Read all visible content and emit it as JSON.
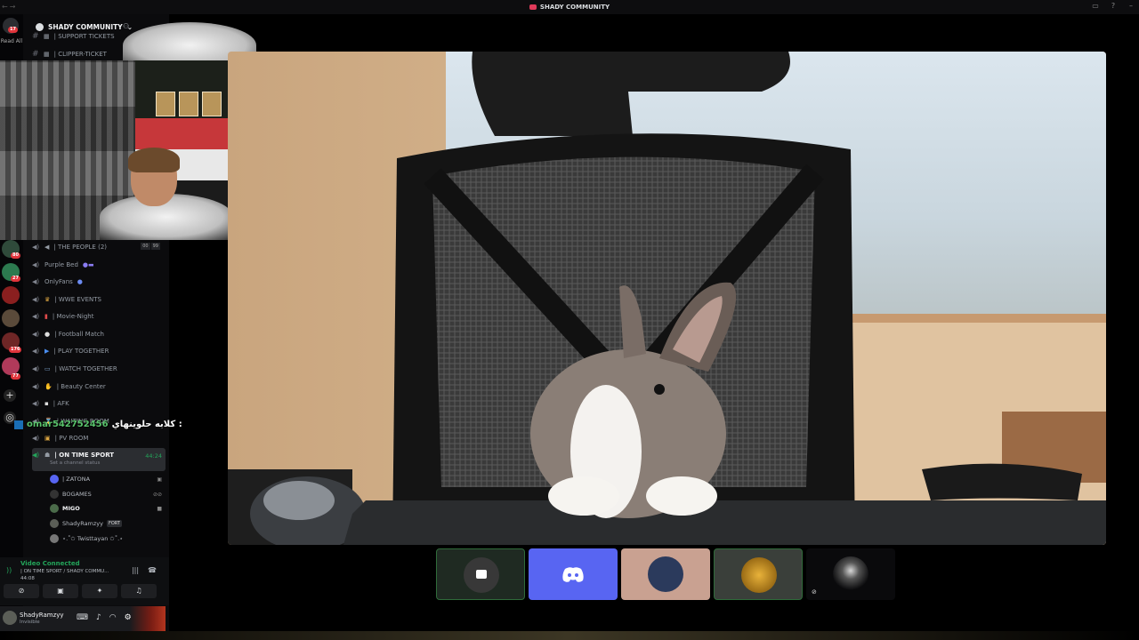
{
  "window": {
    "title": "SHADY COMMUNITY"
  },
  "rail": {
    "read_all": "Read All",
    "badges": [
      "17",
      "80",
      "27",
      "176",
      "77"
    ]
  },
  "server": {
    "name": "SHADY COMMUNITY",
    "top_channels": [
      {
        "icon": "ticket-icon",
        "label": "| SUPPORT TICKETS"
      },
      {
        "icon": "ticket-icon",
        "label": "| CLIPPER-TICKET"
      }
    ],
    "voice_channels": [
      {
        "icon": "speaker-icon",
        "label": "| THE PEOPLE (2)",
        "limit_a": "00",
        "limit_b": "99"
      },
      {
        "icon": "bed-icon",
        "label": "Purple Bed"
      },
      {
        "icon": "globe-icon",
        "label": "OnlyFans"
      },
      {
        "icon": "wrestler-icon",
        "label": "| WWE EVENTS"
      },
      {
        "icon": "popcorn-icon",
        "label": "| Movie-Night"
      },
      {
        "icon": "soccer-icon",
        "label": "| Football Match"
      },
      {
        "icon": "play-icon",
        "label": "| PLAY TOGETHER"
      },
      {
        "icon": "tv-icon",
        "label": "| WATCH TOGETHER"
      },
      {
        "icon": "nail-icon",
        "label": "| Beauty Center"
      },
      {
        "icon": "chat-icon",
        "label": "| AFK"
      },
      {
        "icon": "hourglass-icon",
        "label": "| WAITING ROOM"
      },
      {
        "icon": "lock-icon",
        "label": "| PV ROOM"
      }
    ],
    "active_channel": {
      "label": "| ON TIME SPORT",
      "timer": "44:24",
      "status": "Set a channel status"
    },
    "voice_users": [
      {
        "name": "| ZATONA",
        "color": "#5865f2"
      },
      {
        "name": "BOGAMES",
        "color": "#333333"
      },
      {
        "name": "MIGO",
        "color": "#4b6b4a"
      },
      {
        "name": "ShadyRamzyy",
        "tag": "FORT",
        "color": "#5b5e57"
      },
      {
        "name": "⋆.˚✩ Twisttayan ✩˚.⋆",
        "color": "#777777"
      }
    ]
  },
  "chat_overlay": {
    "username": "omar542752456",
    "message": "كلابه حلوينهاي :"
  },
  "voice_panel": {
    "status": "Video Connected",
    "location": "| ON TIME SPORT / SHADY COMMU...",
    "elapsed": "44:08"
  },
  "user_panel": {
    "name": "ShadyRamzyy",
    "status": "Invisible"
  },
  "colors": {
    "accent": "#5865f2",
    "connected": "#23a55a",
    "badge": "#e0343b"
  }
}
